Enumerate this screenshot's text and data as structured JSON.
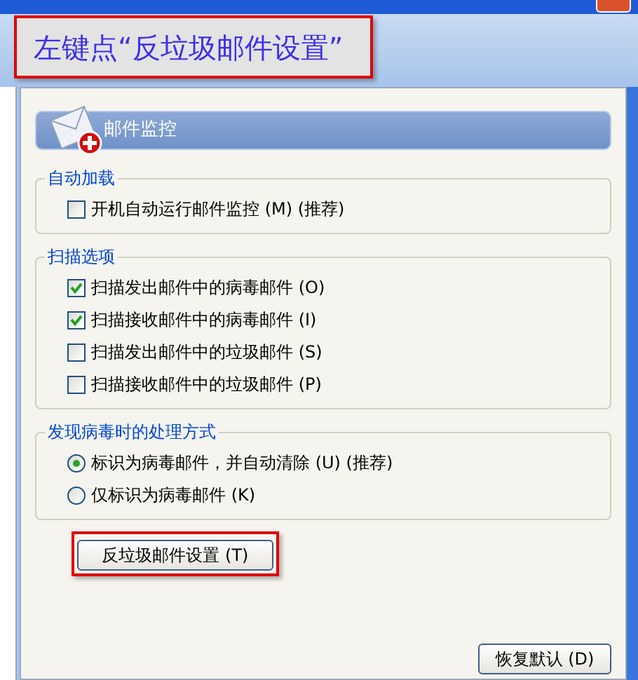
{
  "annotation": {
    "text": "左键点“反垃圾邮件设置”"
  },
  "panel": {
    "title": "邮件监控"
  },
  "groups": [
    {
      "title": "自动加载",
      "items": [
        {
          "kind": "checkbox",
          "label": "开机自动运行邮件监控 (M) (推荐)",
          "checked": false
        }
      ]
    },
    {
      "title": "扫描选项",
      "items": [
        {
          "kind": "checkbox",
          "label": "扫描发出邮件中的病毒邮件 (O)",
          "checked": true
        },
        {
          "kind": "checkbox",
          "label": "扫描接收邮件中的病毒邮件 (I)",
          "checked": true
        },
        {
          "kind": "checkbox",
          "label": "扫描发出邮件中的垃圾邮件 (S)",
          "checked": false
        },
        {
          "kind": "checkbox",
          "label": "扫描接收邮件中的垃圾邮件 (P)",
          "checked": false
        }
      ]
    },
    {
      "title": "发现病毒时的处理方式",
      "items": [
        {
          "kind": "radio",
          "label": "标识为病毒邮件，并自动清除 (U) (推荐)",
          "selected": true
        },
        {
          "kind": "radio",
          "label": "仅标识为病毒邮件 (K)",
          "selected": false
        }
      ]
    }
  ],
  "spam_button": {
    "label": "反垃圾邮件设置 (T)",
    "highlighted": true
  },
  "footer_button": {
    "label": "恢复默认 (D)"
  }
}
